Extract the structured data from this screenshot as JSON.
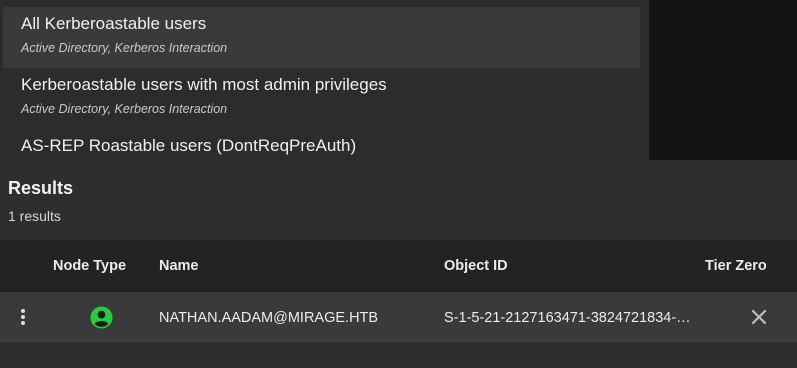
{
  "queries": [
    {
      "title": "All Kerberoastable users",
      "subtitle": "Active Directory, Kerberos Interaction",
      "selected": true
    },
    {
      "title": "Kerberoastable users with most admin privileges",
      "subtitle": "Active Directory, Kerberos Interaction",
      "selected": false
    },
    {
      "title": "AS-REP Roastable users (DontReqPreAuth)",
      "subtitle": "",
      "selected": false
    }
  ],
  "results": {
    "title": "Results",
    "count_text": "1 results",
    "columns": {
      "node_type": "Node Type",
      "name": "Name",
      "object_id": "Object ID",
      "tier_zero": "Tier Zero"
    },
    "rows": [
      {
        "node_type_icon": "user-icon",
        "name": "NATHAN.AADAM@MIRAGE.HTB",
        "object_id": "S-1-5-21-2127163471-3824721834-…",
        "tier_zero_icon": "close-icon"
      }
    ]
  },
  "colors": {
    "user_icon": "#1fd13a",
    "panel_bg": "#2e2e2e",
    "header_bg": "#232323"
  }
}
